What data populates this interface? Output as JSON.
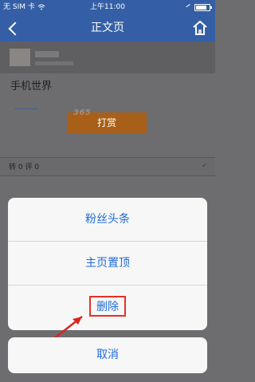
{
  "status_bar": {
    "carrier": "无 SIM 卡",
    "time": "上午11:00",
    "wifi_icon": "wifi-icon",
    "location_icon": "location-icon",
    "battery_icon": "battery-icon"
  },
  "nav_bar": {
    "title": "正文页",
    "back_icon": "chevron-left-icon",
    "home_icon": "home-icon"
  },
  "article": {
    "title": "手机世界",
    "reward_button": "打赏",
    "stats": "转 0 评 0",
    "watermark_1": "365",
    "watermark_2": "cccom"
  },
  "action_sheet": {
    "items": [
      "粉丝头条",
      "主页置顶",
      "删除"
    ],
    "cancel": "取消"
  },
  "colors": {
    "nav_blue": "#345fa6",
    "action_blue": "#1f6bd8",
    "highlight_red": "#e53126",
    "reward_orange": "#a85f19"
  }
}
